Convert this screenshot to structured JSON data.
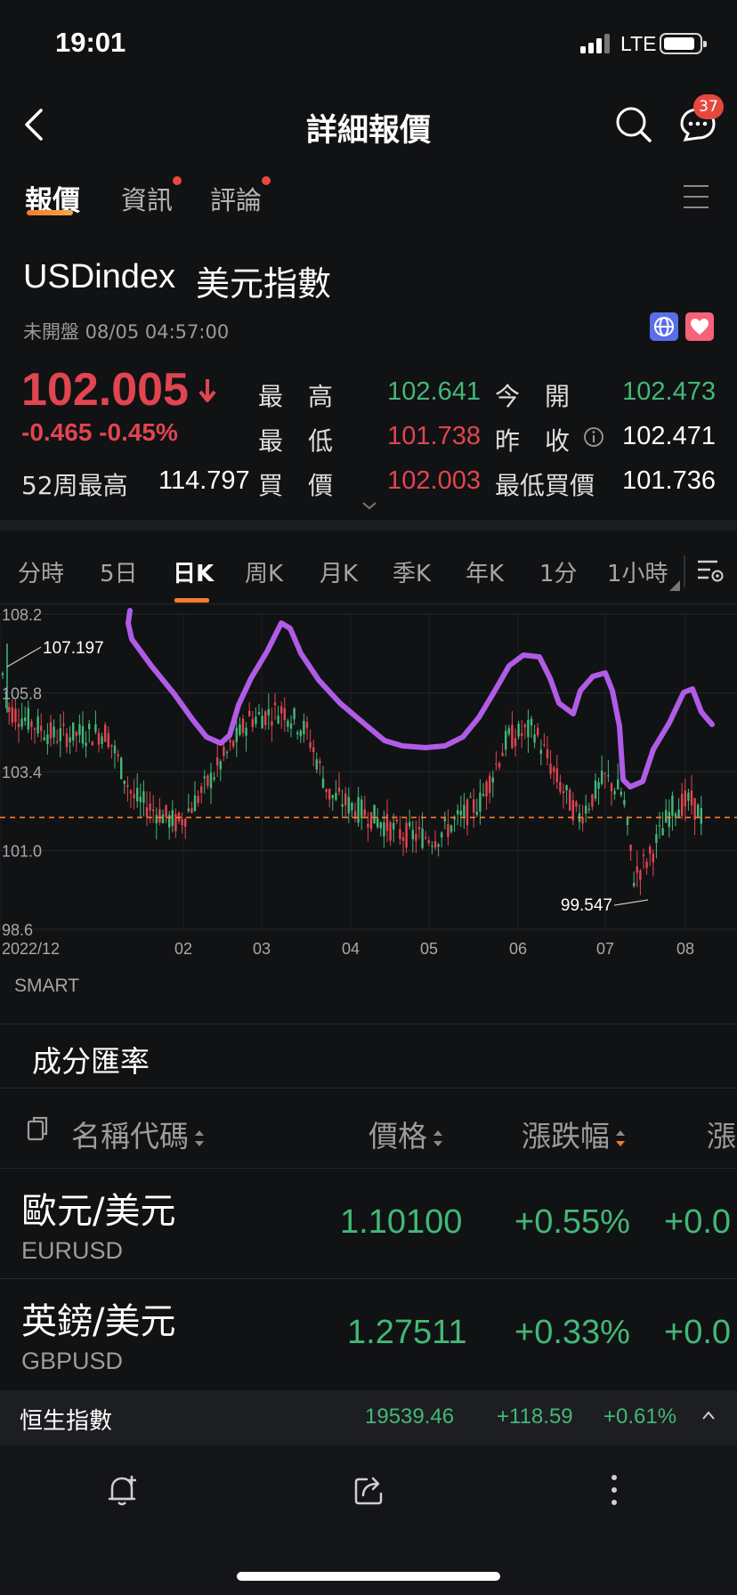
{
  "status_bar": {
    "time": "19:01",
    "network": "LTE"
  },
  "header": {
    "title": "詳細報價",
    "badge_count": "37"
  },
  "tabs": [
    {
      "label": "報價",
      "active": true
    },
    {
      "label": "資訊",
      "dot": true
    },
    {
      "label": "評論",
      "dot": true
    }
  ],
  "instrument": {
    "code": "USDindex",
    "name": "美元指數",
    "status": "未開盤 08/05 04:57:00",
    "price": "102.005",
    "change": "-0.465 -0.45%",
    "wk52_high_label": "52周最高",
    "wk52_high_value": "114.797"
  },
  "stats": {
    "high_label": "最　高",
    "high_value": "102.641",
    "open_label": "今　開",
    "open_value": "102.473",
    "low_label": "最　低",
    "low_value": "101.738",
    "prev_close_label": "昨　收",
    "prev_close_value": "102.471",
    "bid_label": "買　價",
    "bid_value": "102.003",
    "min_bid_label": "最低買價",
    "min_bid_value": "101.736"
  },
  "chart_tabs": [
    "分時",
    "5日",
    "日K",
    "周K",
    "月K",
    "季K",
    "年K",
    "1分",
    "1小時"
  ],
  "chart_tabs_active": "日K",
  "chart_data": {
    "type": "candlestick",
    "y_ticks": [
      "108.2",
      "105.8",
      "103.4",
      "101.0",
      "98.6"
    ],
    "ylim": [
      98.6,
      108.2
    ],
    "x_ticks": [
      "2022/12",
      "02",
      "03",
      "04",
      "05",
      "06",
      "07",
      "08"
    ],
    "max_marker": "107.197",
    "min_marker": "99.547",
    "current_price_line": 102.005,
    "indicator": "SMART"
  },
  "components": {
    "title": "成分匯率",
    "columns": {
      "name": "名稱代碼",
      "price": "價格",
      "change_pct": "漲跌幅",
      "change": "漲"
    },
    "rows": [
      {
        "name": "歐元/美元",
        "code": "EURUSD",
        "price": "1.10100",
        "change_pct": "+0.55%",
        "change": "+0.0"
      },
      {
        "name": "英鎊/美元",
        "code": "GBPUSD",
        "price": "1.27511",
        "change_pct": "+0.33%",
        "change": "+0.0"
      }
    ]
  },
  "ticker": {
    "name": "恒生指數",
    "price": "19539.46",
    "change": "+118.59",
    "change_pct": "+0.61%"
  },
  "colors": {
    "up": "#43b877",
    "down": "#e04550",
    "accent": "#f57c2b",
    "annotation": "#b05ce6"
  }
}
